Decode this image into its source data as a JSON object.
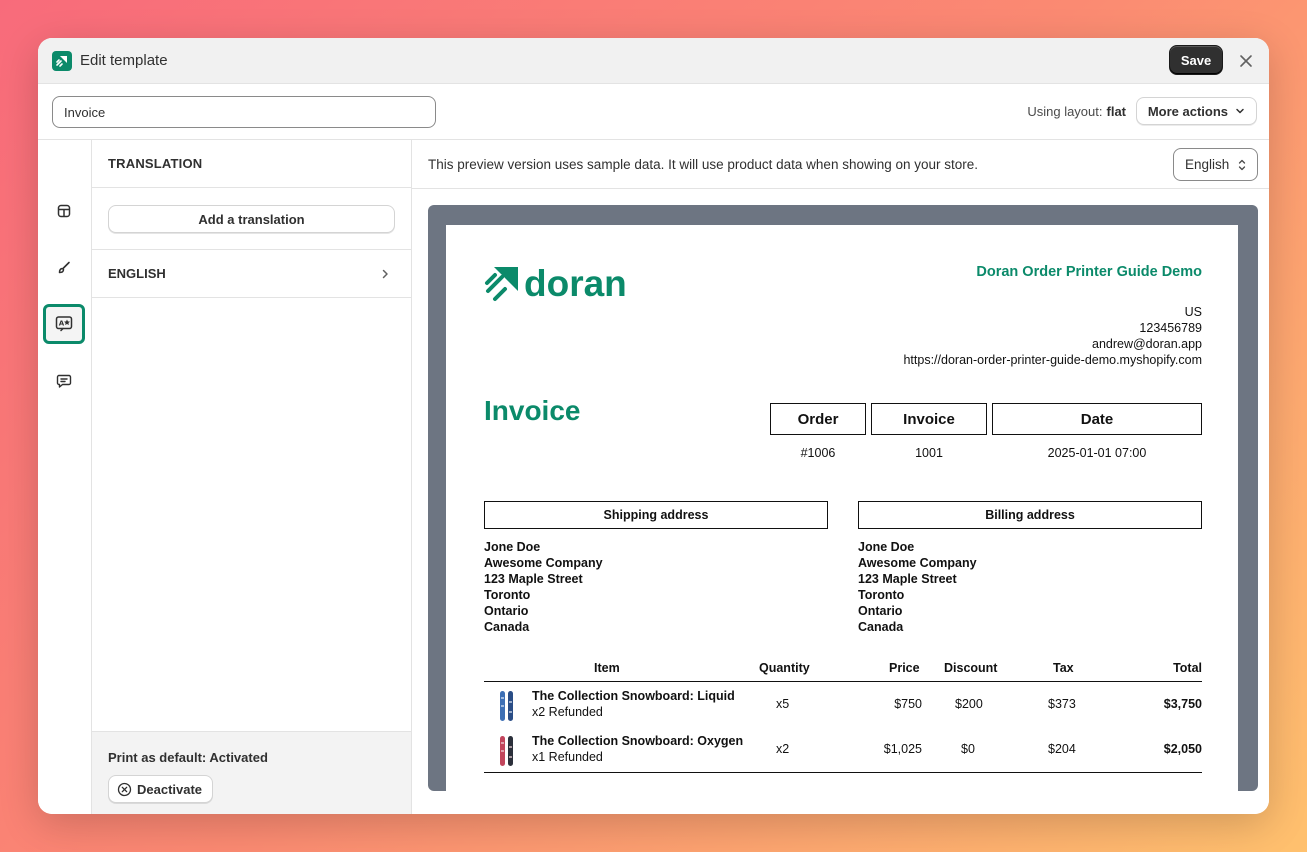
{
  "window": {
    "title": "Edit template",
    "save_label": "Save"
  },
  "toolbar": {
    "template_name": "Invoice",
    "layout_label": "Using layout:",
    "layout_value": "flat",
    "more_actions_label": "More actions"
  },
  "rail": {
    "items": [
      {
        "icon": "layout-icon",
        "active": false
      },
      {
        "icon": "paintbrush-icon",
        "active": false
      },
      {
        "icon": "translation-icon",
        "active": true
      },
      {
        "icon": "chat-icon",
        "active": false
      }
    ]
  },
  "panel": {
    "header": "TRANSLATION",
    "add_translation_label": "Add a translation",
    "language_item": "ENGLISH",
    "default_status": "Print as default: Activated",
    "deactivate_label": "Deactivate"
  },
  "preview": {
    "note": "This preview version uses sample data. It will use product data when showing on your store.",
    "language": "English"
  },
  "invoice": {
    "brand_name": "doran",
    "shop_name": "Doran Order Printer Guide Demo",
    "shop_country": "US",
    "shop_phone": "123456789",
    "shop_email": "andrew@doran.app",
    "shop_url": "https://doran-order-printer-guide-demo.myshopify.com",
    "title": "Invoice",
    "meta_headers": {
      "order": "Order",
      "invoice": "Invoice",
      "date": "Date"
    },
    "meta_values": {
      "order": "#1006",
      "invoice": "1001",
      "date": "2025-01-01 07:00"
    },
    "shipping": {
      "header": "Shipping address",
      "name": "Jone Doe",
      "company": "Awesome Company",
      "street": "123 Maple Street",
      "city": "Toronto",
      "province": "Ontario",
      "country": "Canada"
    },
    "billing": {
      "header": "Billing address",
      "name": "Jone Doe",
      "company": "Awesome Company",
      "street": "123 Maple Street",
      "city": "Toronto",
      "province": "Ontario",
      "country": "Canada"
    },
    "columns": {
      "item": "Item",
      "quantity": "Quantity",
      "price": "Price",
      "discount": "Discount",
      "tax": "Tax",
      "total": "Total"
    },
    "items": [
      {
        "name": "The Collection Snowboard: Liquid",
        "note": "x2 Refunded",
        "quantity": "x5",
        "price": "$750",
        "discount": "$200",
        "tax": "$373",
        "total": "$3,750",
        "thumb_color": "#3d6fb5"
      },
      {
        "name": "The Collection Snowboard: Oxygen",
        "note": "x1 Refunded",
        "quantity": "x2",
        "price": "$1,025",
        "discount": "$0",
        "tax": "$204",
        "total": "$2,050",
        "thumb_color": "#c2455c"
      }
    ]
  },
  "colors": {
    "brand": "#0b8a6a",
    "primary_button": "#303030",
    "frame": "#6d7582"
  }
}
